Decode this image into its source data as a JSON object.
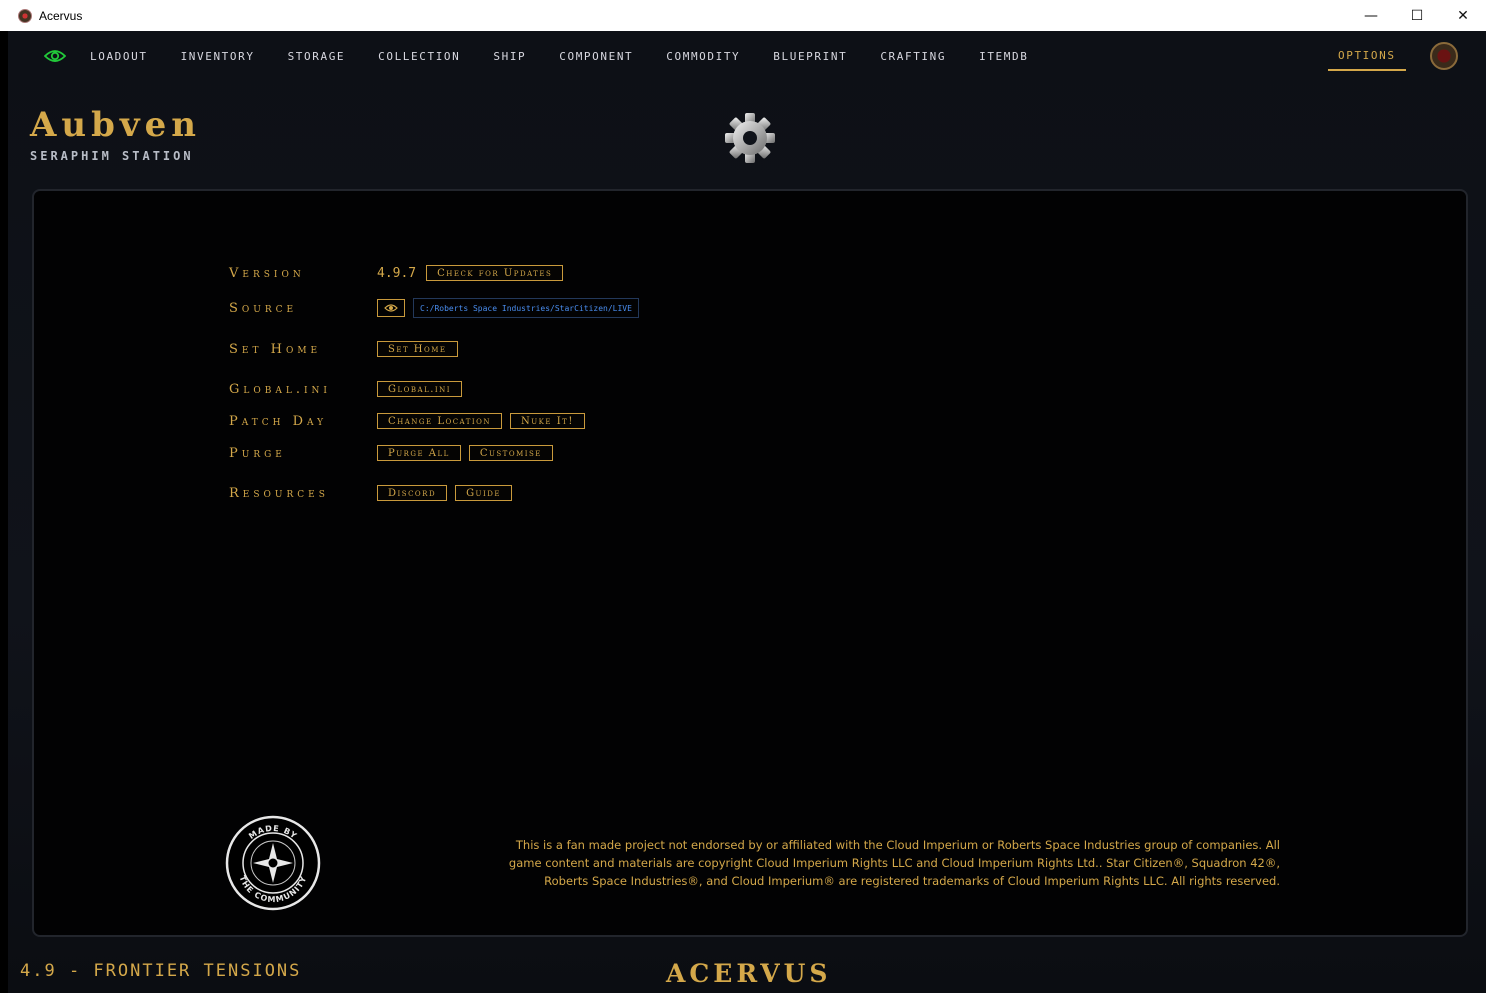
{
  "window": {
    "title": "Acervus",
    "minimize": "—",
    "maximize": "☐",
    "close": "✕"
  },
  "nav": {
    "items": [
      "LOADOUT",
      "INVENTORY",
      "STORAGE",
      "COLLECTION",
      "SHIP",
      "COMPONENT",
      "COMMODITY",
      "BLUEPRINT",
      "CRAFTING",
      "ITEMDB"
    ],
    "options": "OPTIONS",
    "eye_color": "#22c93a"
  },
  "location": {
    "title": "Aubven",
    "subtitle": "SERAPHIM STATION"
  },
  "settings": {
    "version_label": "Version",
    "version_value": "4.9.7",
    "check_updates": "Check for Updates",
    "source_label": "Source",
    "source_path": "C:/Roberts Space Industries/StarCitizen/LIVE",
    "set_home_label": "Set Home",
    "set_home_button": "Set Home",
    "global_label": "Global.ini",
    "global_button": "Global.ini",
    "patch_day_label": "Patch Day",
    "change_location": "Change Location",
    "nuke_it": "Nuke It!",
    "purge_label": "Purge",
    "purge_all": "Purge All",
    "customise": "Customise",
    "resources_label": "Resources",
    "discord": "Discord",
    "guide": "Guide"
  },
  "disclaimer": {
    "line1": "This is a fan made project not endorsed by or affiliated with the Cloud Imperium or Roberts Space Industries group of companies. All",
    "line2": "game content and materials are copyright Cloud Imperium Rights LLC and Cloud Imperium Rights Ltd.. Star Citizen®, Squadron 42®,",
    "line3": "Roberts Space Industries®, and Cloud Imperium® are registered trademarks of Cloud Imperium Rights LLC. All rights reserved."
  },
  "badge": {
    "top_text": "MADE BY",
    "bottom_text": "THE COMMUNITY"
  },
  "footer": {
    "version": "4.9 - FRONTIER TENSIONS",
    "brand": "ACERVUS"
  },
  "colors": {
    "accent": "#d4a84a",
    "path_text": "#4a8ef0"
  }
}
